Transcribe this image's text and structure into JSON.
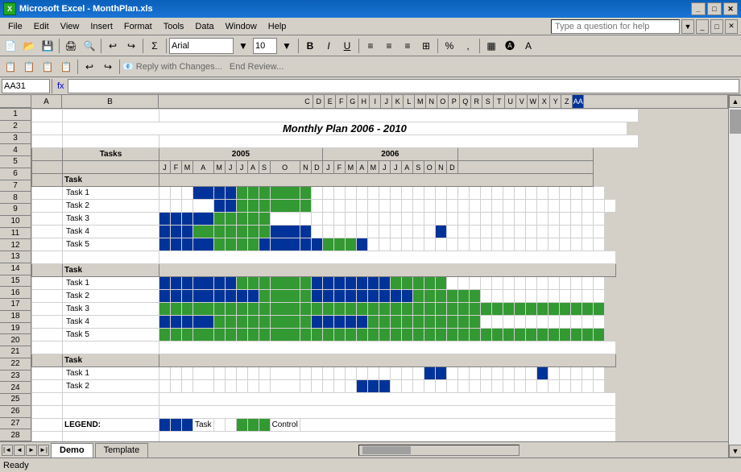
{
  "titleBar": {
    "title": "Microsoft Excel - MonthPlan.xls",
    "icon": "X",
    "controls": [
      "_",
      "□",
      "✕"
    ]
  },
  "menuBar": {
    "items": [
      "File",
      "Edit",
      "View",
      "Insert",
      "Format",
      "Tools",
      "Data",
      "Window",
      "Help"
    ]
  },
  "questionBox": {
    "placeholder": "Type a question for help"
  },
  "toolbar1": {
    "font": "Arial",
    "size": "10"
  },
  "formulaBar": {
    "nameBox": "AA31",
    "fx": "fx"
  },
  "sheet": {
    "title": "Monthly Plan 2006 - 2010",
    "activeTab": "Demo",
    "tabs": [
      "Demo",
      "Template"
    ]
  },
  "statusBar": {
    "text": "Ready"
  },
  "legend": {
    "label": "LEGEND:",
    "task": "Task",
    "control": "Control"
  }
}
